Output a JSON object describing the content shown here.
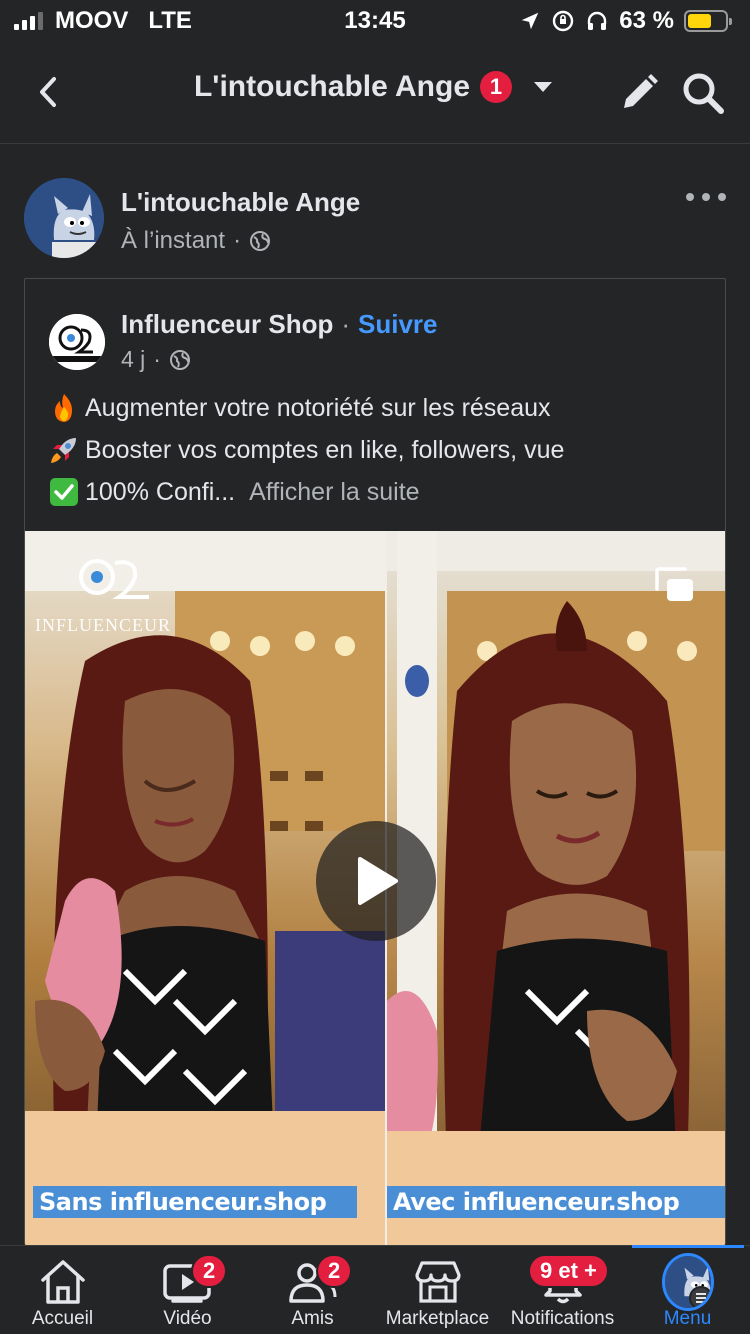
{
  "status_bar": {
    "carrier": "MOOV",
    "network": "LTE",
    "time": "13:45",
    "battery_percent_label": "63 %",
    "battery_level": 0.63,
    "battery_color": "#ffd60a"
  },
  "header": {
    "title": "L'intouchable Ange",
    "notification_count": "1",
    "back_icon": "chevron-left-icon",
    "edit_icon": "pencil-icon",
    "search_icon": "search-icon"
  },
  "post": {
    "author": "L'intouchable Ange",
    "time": "À l’instant",
    "separator": "·",
    "privacy_icon": "globe-icon",
    "shared": {
      "page_name": "Influenceur Shop",
      "separator": "·",
      "follow_label": "Suivre",
      "time": "4 j",
      "text_lines": [
        {
          "emoji": "fire-emoji",
          "text": "Augmenter votre notoriété sur les réseaux"
        },
        {
          "emoji": "rocket-emoji",
          "text": "Booster vos comptes en like, followers, vue"
        },
        {
          "emoji": "check-emoji",
          "text": "100% Confi..."
        }
      ],
      "see_more": "Afficher la suite",
      "video": {
        "brand_text": "INFLUENCEUR",
        "caption_left": "Sans influenceur.shop",
        "caption_right": "Avec influenceur.shop",
        "caption_color": "#4a8fd6"
      }
    }
  },
  "tabbar": {
    "accent": "#2d88ff",
    "badge_color": "#e41e3f",
    "tabs": [
      {
        "label": "Accueil",
        "icon": "home-icon",
        "badge": ""
      },
      {
        "label": "Vidéo",
        "icon": "video-icon",
        "badge": "2"
      },
      {
        "label": "Amis",
        "icon": "friends-icon",
        "badge": "2"
      },
      {
        "label": "Marketplace",
        "icon": "marketplace-icon",
        "badge": ""
      },
      {
        "label": "Notifications",
        "icon": "bell-icon",
        "badge": "9 et +"
      },
      {
        "label": "Menu",
        "icon": "menu-avatar-icon",
        "badge": ""
      }
    ]
  }
}
